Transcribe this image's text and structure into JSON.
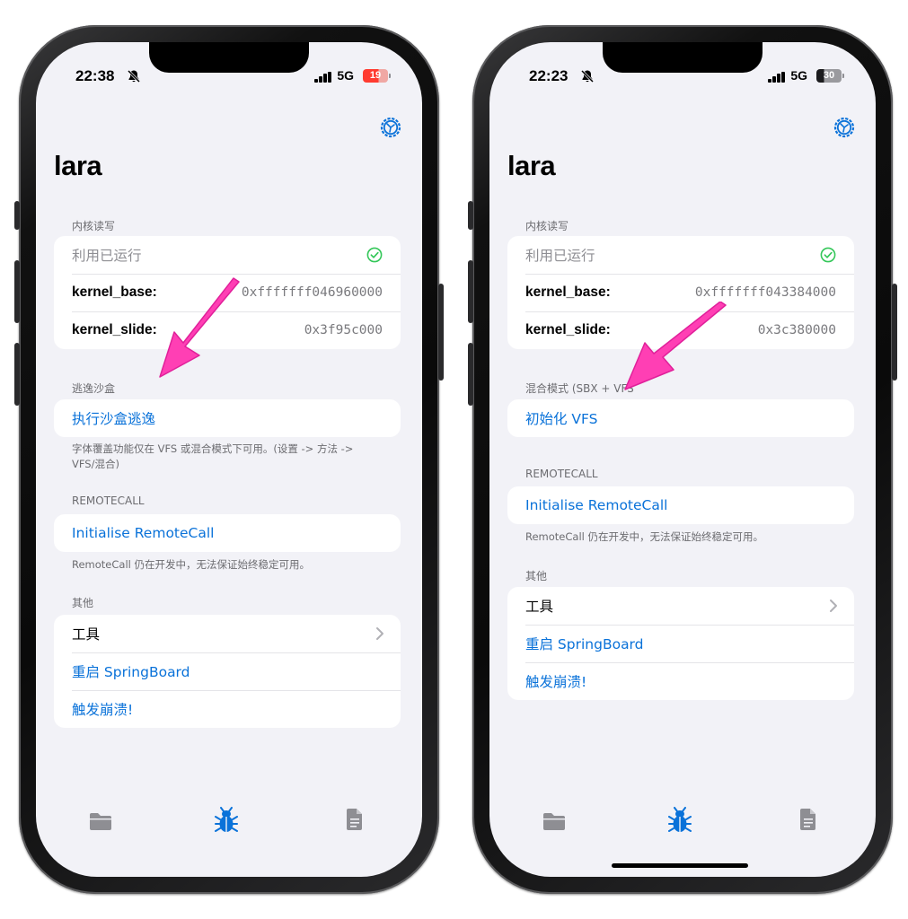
{
  "screens": [
    {
      "status_bar": {
        "time": "22:38",
        "network": "5G",
        "battery": "19",
        "battery_color": "#ff3b30"
      },
      "app_title": "lara",
      "kernel": {
        "header": "内核读写",
        "exploit_label": "利用已运行",
        "base_label": "kernel_base:",
        "base_value": "0xfffffff046960000",
        "slide_label": "kernel_slide:",
        "slide_value": "0x3f95c000"
      },
      "sandbox": {
        "header": "逃逸沙盒",
        "action": "执行沙盒逃逸",
        "footer": "字体覆盖功能仅在 VFS 或混合模式下可用。(设置 -> 方法 -> VFS/混合)"
      },
      "remotecall": {
        "header": "REMOTECALL",
        "action": "Initialise RemoteCall",
        "footer": "RemoteCall 仍在开发中，无法保证始终稳定可用。"
      },
      "other": {
        "header": "其他",
        "tools": "工具",
        "respring": "重启 SpringBoard",
        "crash": "触发崩溃!"
      }
    },
    {
      "status_bar": {
        "time": "22:23",
        "network": "5G",
        "battery": "30",
        "battery_color": "#1c1c1e"
      },
      "app_title": "lara",
      "kernel": {
        "header": "内核读写",
        "exploit_label": "利用已运行",
        "base_label": "kernel_base:",
        "base_value": "0xfffffff043384000",
        "slide_label": "kernel_slide:",
        "slide_value": "0x3c380000"
      },
      "hybrid": {
        "header": "混合模式 (SBX + VFS",
        "action": "初始化 VFS"
      },
      "remotecall": {
        "header": "REMOTECALL",
        "action": "Initialise RemoteCall",
        "footer": "RemoteCall 仍在开发中，无法保证始终稳定可用。"
      },
      "other": {
        "header": "其他",
        "tools": "工具",
        "respring": "重启 SpringBoard",
        "crash": "触发崩溃!"
      }
    }
  ],
  "tab_bar": {
    "icons": [
      "folder-icon",
      "bug-icon",
      "document-icon"
    ],
    "active_color": "#0a72d9",
    "inactive_color": "#8e8e93"
  },
  "accent_color": "#0a72d9",
  "annotation_arrow_color": "#ff3fb4"
}
